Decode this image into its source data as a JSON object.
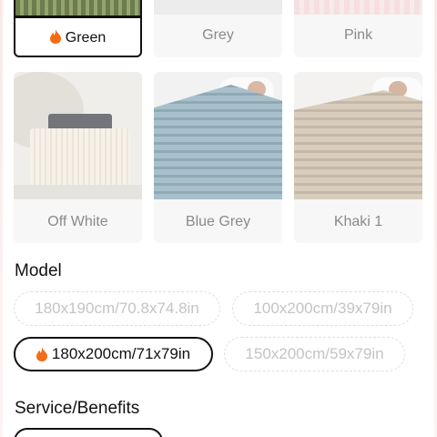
{
  "colors": {
    "selected_border": "#111111",
    "muted_text": "#8a8a8a",
    "flame_accent": "#f36d16"
  },
  "color_options": [
    {
      "label": "Green",
      "selected": true,
      "hot": true
    },
    {
      "label": "Grey",
      "selected": false
    },
    {
      "label": "Pink",
      "selected": false
    },
    {
      "label": "Off White",
      "selected": false
    },
    {
      "label": "Blue Grey",
      "selected": false
    },
    {
      "label": "Khaki 1",
      "selected": false
    }
  ],
  "model": {
    "title": "Model",
    "options": [
      {
        "label": "180x190cm/70.8x74.8in",
        "selected": false
      },
      {
        "label": "100x200cm/39x79in",
        "selected": false
      },
      {
        "label": "180x200cm/71x79in",
        "selected": true,
        "hot": true
      },
      {
        "label": "150x200cm/59x79in",
        "selected": false
      }
    ]
  },
  "service": {
    "title": "Service/Benefits"
  }
}
